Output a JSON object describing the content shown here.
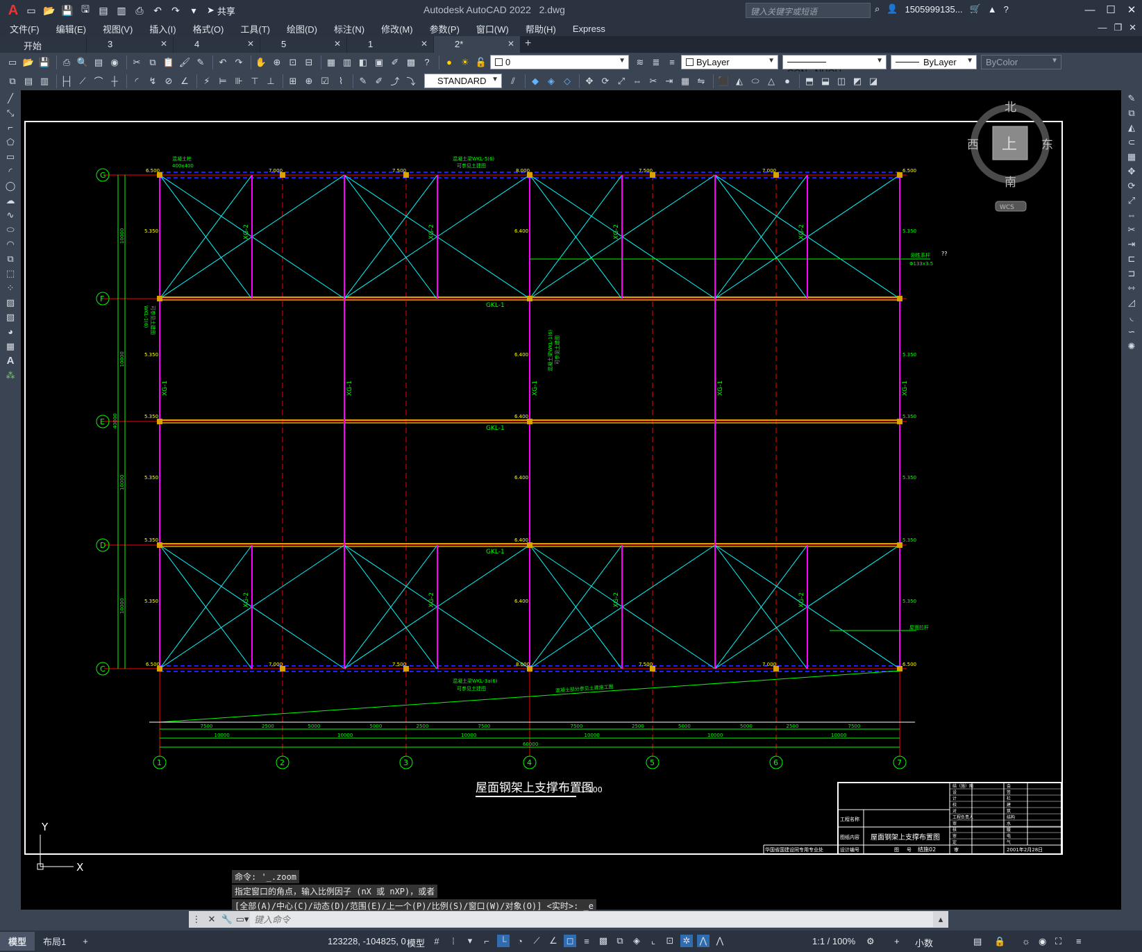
{
  "app": {
    "title": "Autodesk AutoCAD 2022",
    "file": "2.dwg",
    "share_label": "共享",
    "search_placeholder": "键入关键字或短语",
    "user": "1505999135...",
    "logo": "A"
  },
  "menu": [
    "文件(F)",
    "编辑(E)",
    "视图(V)",
    "插入(I)",
    "格式(O)",
    "工具(T)",
    "绘图(D)",
    "标注(N)",
    "修改(M)",
    "参数(P)",
    "窗口(W)",
    "帮助(H)",
    "Express"
  ],
  "tabs": [
    {
      "label": "开始"
    },
    {
      "label": "3"
    },
    {
      "label": "4"
    },
    {
      "label": "5"
    },
    {
      "label": "1"
    },
    {
      "label": "2*"
    }
  ],
  "toolbar": {
    "layer": "0",
    "color": "ByLayer",
    "linetype": "CON...NUOU",
    "lineweight": "ByLayer",
    "plotstyle": "ByColor",
    "textstyle": "STANDARD"
  },
  "viewcube": {
    "north": "北",
    "south": "南",
    "east": "东",
    "west": "西",
    "top": "上",
    "wcs": "WCS"
  },
  "drawing": {
    "grid_rows": [
      "G",
      "F",
      "E",
      "D",
      "C"
    ],
    "grid_cols": [
      "1",
      "2",
      "3",
      "4",
      "5",
      "6",
      "7"
    ],
    "title": "屋面钢架上支撑布置图",
    "scale": "1:100",
    "beam_label": "GKL-1",
    "xg1": "XG-1",
    "xg2": "XG-2",
    "top_elev": [
      "6.500",
      "7.000",
      "7.500",
      "8.000",
      "7.500",
      "7.000",
      "6.500"
    ],
    "mid_elev_left": "5.350",
    "mid_elev_center": "6.400",
    "note_top_left": "混凝土柱",
    "note_top_left_2": "400x400",
    "note_top": "混凝土梁WKL-5(6)",
    "note_top_2": "可参见土建图",
    "note_left": "WKL-1(6)",
    "note_left_2": "可参见土建图",
    "note_mid": "混凝土梁WKL-1(6)",
    "note_mid_2": "可参见土建图",
    "note_bottom": "混凝土梁WKL-3a(6)",
    "note_bottom_2": "可参见土建图",
    "note_slope": "混凝土部分参见土建施工图",
    "note_right1": "刚性系杆",
    "note_right1_2": "Φ133x3.5",
    "note_right2": "屋面拉杆",
    "qq": "??",
    "dims_row1": [
      "7500",
      "2500",
      "5000",
      "5000",
      "2500",
      "7500",
      "7500",
      "2500",
      "5000",
      "5000",
      "2500",
      "7500"
    ],
    "dims_row2": [
      "10000",
      "10000",
      "10000",
      "10000",
      "10000",
      "10000"
    ],
    "dims_total": "60000",
    "dims_vertical": [
      "10000",
      "10000",
      "10000",
      "10000"
    ],
    "dims_vertical_total": "40000",
    "titleblock": {
      "proj_name_label": "工程名称",
      "drawing_label": "图纸内容",
      "drawing_value": "屋面钢架上支撑布置图",
      "design_no_label": "设计编号",
      "fig_label": "图",
      "fig_no_label": "号",
      "fig_no": "结施02",
      "review_label": "审",
      "date": "2001年2月28日",
      "company": "华国省国建设同专用专业处",
      "rows_left": [
        "结（施）图",
        "设",
        "计",
        "校",
        "对",
        "工程负责人",
        "审",
        "核",
        "审",
        "定"
      ],
      "rows_right": [
        "会",
        "签",
        "栏",
        "建",
        "筑",
        "结构",
        "水",
        "暖",
        "电",
        "气"
      ]
    },
    "ucs_y": "Y",
    "ucs_x": "X"
  },
  "command": {
    "history": [
      "命令: '_.zoom",
      "指定窗口的角点，输入比例因子 (nX 或 nXP)，或者",
      "[全部(A)/中心(C)/动态(D)/范围(E)/上一个(P)/比例(S)/窗口(W)/对象(O)] <实时>: _e"
    ],
    "placeholder": "键入命令"
  },
  "status": {
    "model_tab": "模型",
    "layout_tab": "布局1",
    "coords": "123228, -104825, 0",
    "model": "模型",
    "scale": "1:1 / 100%",
    "units": "小数"
  },
  "colors": {
    "cyan": "#00ffff",
    "magenta": "#ff00ff",
    "green": "#00ff00",
    "red": "#ff0000",
    "yellow": "#ffff00",
    "blue": "#1e1eff",
    "orange": "#d9a400"
  }
}
